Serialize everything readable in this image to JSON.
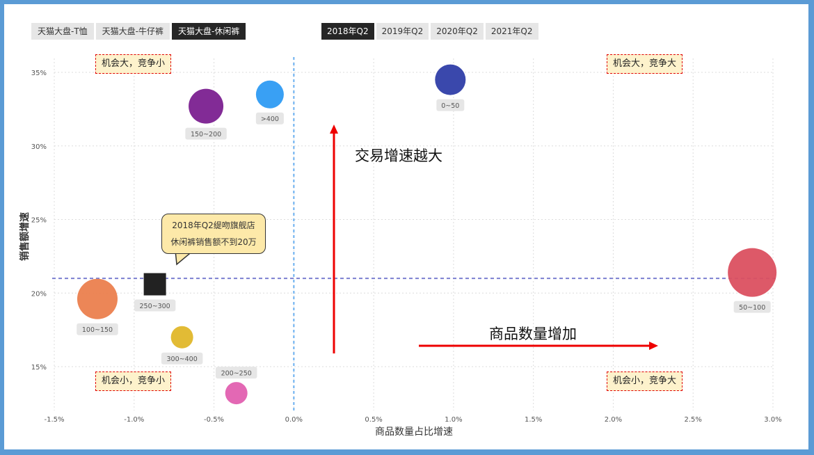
{
  "category_tabs": [
    {
      "label": "天猫大盘-T恤",
      "active": false
    },
    {
      "label": "天猫大盘-牛仔裤",
      "active": false
    },
    {
      "label": "天猫大盘-休闲裤",
      "active": true
    }
  ],
  "year_tabs": [
    {
      "label": "2018年Q2",
      "active": true
    },
    {
      "label": "2019年Q2",
      "active": false
    },
    {
      "label": "2020年Q2",
      "active": false
    },
    {
      "label": "2021年Q2",
      "active": false
    }
  ],
  "quadrants": {
    "top_left": "机会大，竞争小",
    "top_right": "机会大，竞争大",
    "bottom_left": "机会小，竞争小",
    "bottom_right": "机会小，竞争大"
  },
  "callout": {
    "line1": "2018年Q2缇吻旗舰店",
    "line2": "休闲裤销售额不到20万"
  },
  "arrows": {
    "vertical_label": "交易增速越大",
    "horizontal_label": "商品数量增加",
    "color": "#ee0000"
  },
  "chart_data": {
    "type": "scatter",
    "xlabel": "商品数量占比增速",
    "ylabel": "销售额增速",
    "xlim": [
      -1.5,
      3.0
    ],
    "ylim": [
      12.5,
      36.5
    ],
    "xticks": [
      "-1.5%",
      "-1.0%",
      "-0.5%",
      "0.0%",
      "0.5%",
      "1.0%",
      "1.5%",
      "2.0%",
      "2.5%",
      "3.0%"
    ],
    "yticks": [
      "15%",
      "20%",
      "25%",
      "30%",
      "35%"
    ],
    "grid": true,
    "reference_lines": {
      "x": 0.0,
      "y": 21.0
    },
    "points": [
      {
        "label": "0~50",
        "x": 0.98,
        "y": 34.5,
        "color": "#2f3ea8",
        "shape": "circle"
      },
      {
        "label": ">400",
        "x": -0.15,
        "y": 33.5,
        "color": "#2e9bf3",
        "shape": "circle"
      },
      {
        "label": "150~200",
        "x": -0.55,
        "y": 32.7,
        "color": "#7b2090",
        "shape": "circle"
      },
      {
        "label": "50~100",
        "x": 2.87,
        "y": 21.4,
        "color": "#db5060",
        "shape": "circle"
      },
      {
        "label": "250~300",
        "x": -0.87,
        "y": 20.6,
        "color": "#222222",
        "shape": "square"
      },
      {
        "label": "100~150",
        "x": -1.23,
        "y": 19.6,
        "color": "#eb7f4e",
        "shape": "circle"
      },
      {
        "label": "300~400",
        "x": -0.7,
        "y": 17.0,
        "color": "#e0b72a",
        "shape": "circle"
      },
      {
        "label": "200~250",
        "x": -0.36,
        "y": 13.2,
        "color": "#e160b0",
        "shape": "circle"
      }
    ]
  }
}
